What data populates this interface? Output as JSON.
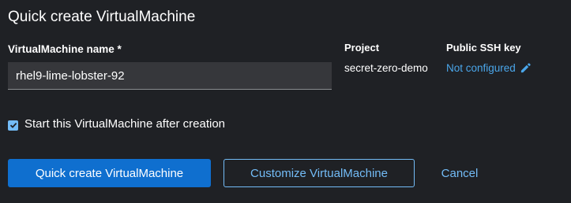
{
  "dialog": {
    "title": "Quick create VirtualMachine"
  },
  "form": {
    "name_label": "VirtualMachine name *",
    "name_value": "rhel9-lime-lobster-92",
    "project_label": "Project",
    "project_value": "secret-zero-demo",
    "ssh_label": "Public SSH key",
    "ssh_value": "Not configured",
    "ssh_edit_icon": "pencil-icon",
    "start_after_creation_label": "Start this VirtualMachine after creation",
    "start_after_creation_checked": true
  },
  "actions": {
    "quick_create_label": "Quick create VirtualMachine",
    "customize_label": "Customize VirtualMachine",
    "cancel_label": "Cancel"
  },
  "colors": {
    "background": "#1f2125",
    "primary": "#0f6fcf",
    "link": "#73bcf7",
    "input_bg": "#36373b"
  }
}
